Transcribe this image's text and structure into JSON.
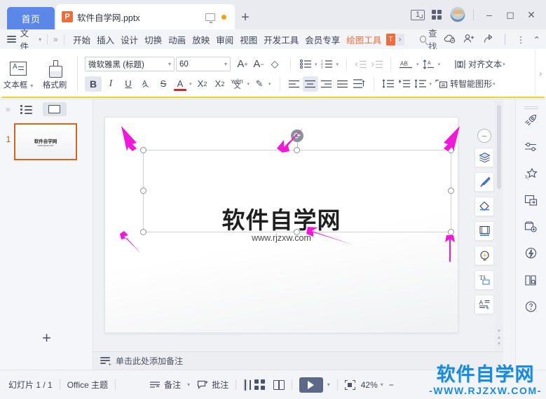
{
  "tabbar": {
    "home_tab": "首页",
    "doc_icon": "P",
    "doc_title": "软件自学网.pptx",
    "new_tab": "+",
    "badge_count": "1"
  },
  "menubar": {
    "file": "文件",
    "items": [
      "开始",
      "插入",
      "设计",
      "切换",
      "动画",
      "放映",
      "审阅",
      "视图",
      "开发工具",
      "会员专享"
    ],
    "active_tool": "绘图工具",
    "badge": "T",
    "expand_chevron": "›",
    "find": "查找",
    "collapse": "⌃",
    "more": "⋮"
  },
  "ribbon": {
    "textbox_label": "文本框",
    "format_painter_label": "格式刷",
    "font_name": "微软雅黑 (标题)",
    "font_size": "60",
    "grow_font": "A",
    "shrink_font": "A",
    "clear_format": "◇",
    "bold": "B",
    "italic": "I",
    "underline": "U",
    "char_border": "A",
    "strikethrough": "S",
    "font_color": "A",
    "superscript": "X",
    "subscript": "X",
    "pinyin": "wén",
    "highlight": "✎",
    "align_text_label": "对齐文本",
    "smartart_label": "转智能图形"
  },
  "left_panel": {
    "collapse": "»",
    "outline_view": "outline-view",
    "slide_view": "slide-view",
    "slide_number": "1",
    "thumb_title": "软件自学网",
    "thumb_sub": "www.rjzxw.com",
    "add_slide": "+"
  },
  "slide": {
    "title": "软件自学网",
    "subtitle": "www.rjzxw.com",
    "rotate_handle": "⟳",
    "zoom_out_float": "−"
  },
  "float_toolbar": {
    "items": [
      "layers-icon",
      "brush-icon",
      "fill-icon",
      "frame-icon",
      "idea-icon",
      "text-box-icon",
      "text-format-icon"
    ]
  },
  "right_rail": {
    "items": [
      "rocket-icon",
      "sliders-icon",
      "sparkle-icon",
      "screen-share-icon",
      "cloud-tool-icon",
      "lightning-icon",
      "book-search-icon",
      "help-icon"
    ]
  },
  "notes": {
    "placeholder": "单击此处添加备注"
  },
  "status": {
    "slide_count": "幻灯片 1 / 1",
    "theme": "Office 主题",
    "notes_btn": "备注",
    "comments_btn": "批注",
    "zoom_level": "42%",
    "zoom_minus": "−",
    "zoom_plus": "+"
  },
  "watermark": {
    "line1": "软件自学网",
    "line2": "-WWW.RJZXW.COM-"
  },
  "colors": {
    "accent_blue": "#5b87e8",
    "brand_orange": "#ec6e3c",
    "selection_orange": "#d4651f",
    "arrow_magenta": "#f218d8",
    "watermark_blue": "#1d8ad6",
    "play_button": "#5c6887"
  }
}
